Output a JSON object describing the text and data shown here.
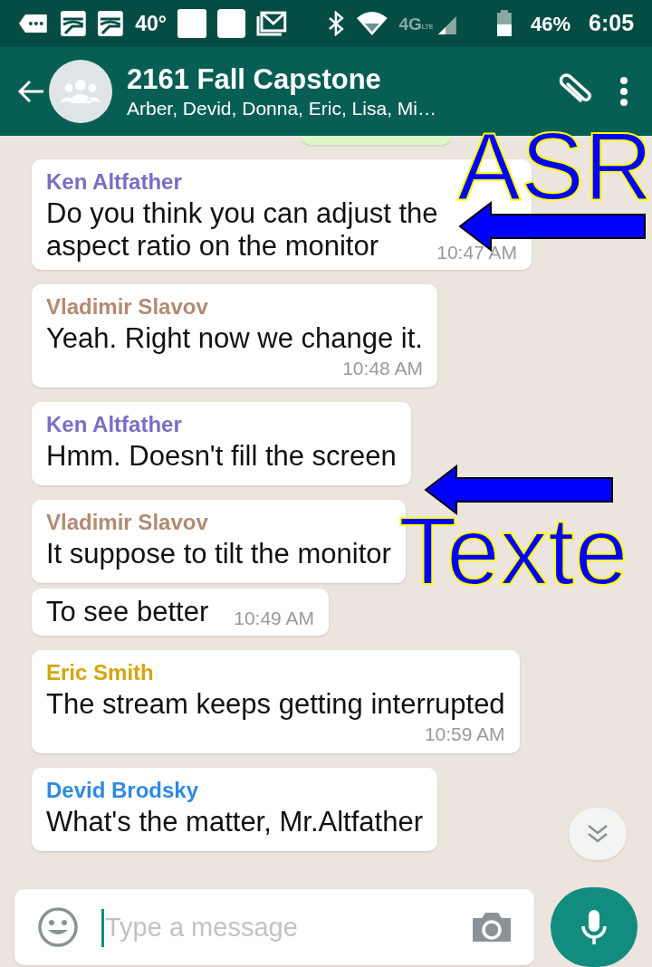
{
  "status_bar": {
    "temperature": "40°",
    "network": "4G",
    "network_sub": "LTE",
    "battery": "46%",
    "time": "6:05"
  },
  "header": {
    "title": "2161 Fall Capstone",
    "subtitle": "Arber, Devid, Donna, Eric, Lisa, Mi…"
  },
  "messages": [
    {
      "sender": "Ken Altfather",
      "color": "#7a6dc4",
      "text": "Do you think you can adjust the aspect ratio on the monitor",
      "time": "10:47 AM",
      "time_inline": true
    },
    {
      "sender": "Vladimir Slavov",
      "color": "#b38a73",
      "text": "Yeah. Right now we change it.",
      "time": "10:48 AM",
      "time_inline": false
    },
    {
      "sender": "Ken Altfather",
      "color": "#7a6dc4",
      "text": "Hmm. Doesn't fill the screen"
    },
    {
      "sender": "Vladimir Slavov",
      "color": "#b38a73",
      "text": "It suppose to tilt the monitor"
    },
    {
      "text": "To see better",
      "time": "10:49 AM",
      "time_inline": true
    },
    {
      "sender": "Eric Smith",
      "color": "#d4a50f",
      "text": "The stream keeps getting interrupted",
      "time": "10:59 AM",
      "time_inline": false
    },
    {
      "sender": "Devid Brodsky",
      "color": "#2f8ae0",
      "text": "What's the matter, Mr.Altfather"
    }
  ],
  "composer": {
    "placeholder": "Type a message"
  },
  "annotations": {
    "top_label": "ASR",
    "lower_label": "Texte"
  }
}
